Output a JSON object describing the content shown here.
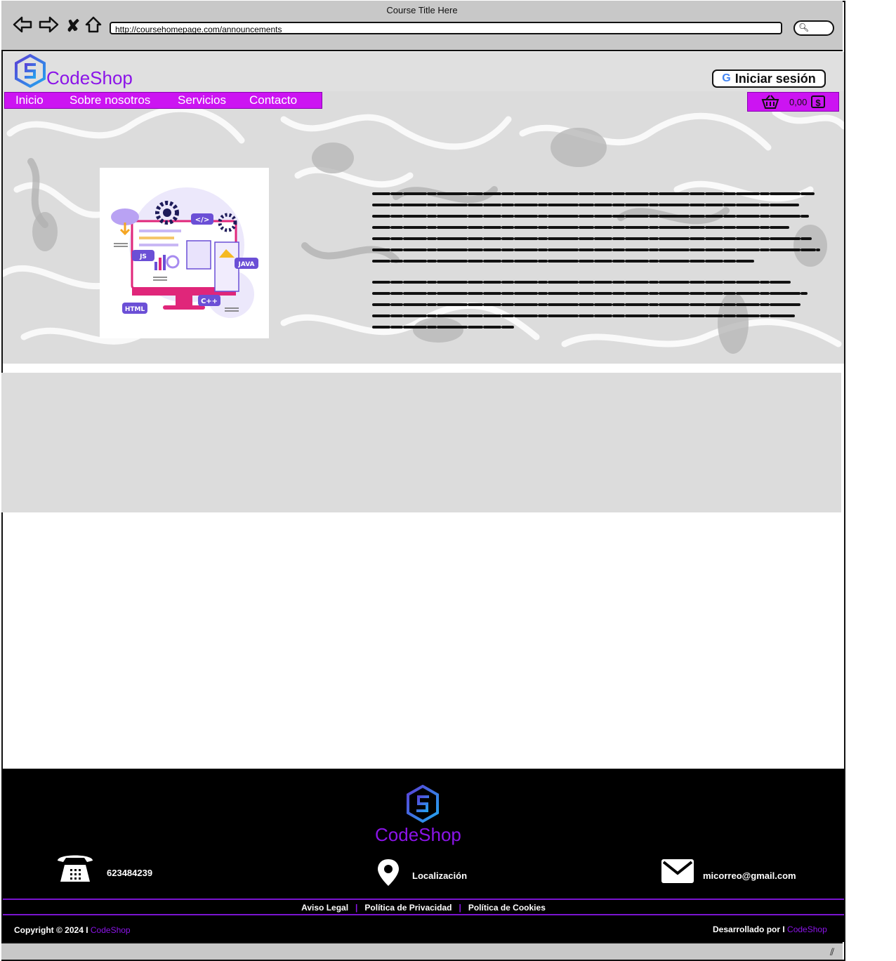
{
  "browser": {
    "title": "Course Title Here",
    "url": "http://coursehomepage.com/announcements",
    "back_icon": "back-arrow-icon",
    "forward_icon": "forward-arrow-icon",
    "close_icon": "close-icon",
    "home_icon": "home-icon",
    "search_icon": "search-icon"
  },
  "header": {
    "brand": "CodeShop",
    "login_label": "Iniciar sesión",
    "login_icon": "google-icon"
  },
  "nav": {
    "items": [
      {
        "label": "Inicio"
      },
      {
        "label": "Sobre nosotros"
      },
      {
        "label": "Servicios"
      },
      {
        "label": "Contacto"
      }
    ]
  },
  "cart": {
    "icon": "basket-icon",
    "total": "0,00",
    "currency": "$"
  },
  "hero": {
    "illustration_tags": [
      "</>",
      "JS",
      "JAVA",
      "HTML",
      "C++"
    ]
  },
  "footer": {
    "brand": "CodeShop",
    "phone": "623484239",
    "location": "Localización",
    "email": "micorreo@gmail.com",
    "legal": {
      "aviso": "Aviso Legal",
      "privacidad": "Política de Privacidad",
      "cookies": "Política de Cookies"
    },
    "copyright_prefix": "Copyright © 2024 I",
    "copyright_brand": "CodeShop",
    "dev_prefix": "Desarrollado por I",
    "dev_brand": "CodeShop"
  },
  "colors": {
    "accent": "#cc14f2",
    "brand": "#8b14e8",
    "footer_bg": "#000000"
  }
}
